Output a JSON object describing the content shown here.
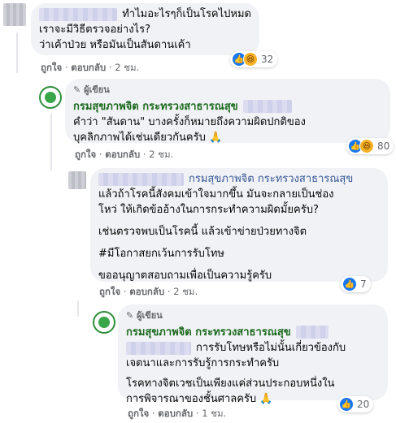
{
  "comments": [
    {
      "lines": [
        "ทำไมอะไรๆก็เป็นโรคไปหมด",
        "เราจะมีวิธีตรวจอย่างไร?",
        "ว่าเค้าป่วย หรือมันเป็นสันดานเค้า"
      ],
      "like": "ถูกใจ",
      "reply": "ตอบกลับ",
      "time": "2 ชม.",
      "reactions": "32"
    },
    {
      "author_tag": "ผู้เขียน",
      "author": "กรมสุขภาพจิต กระทรวงสาธารณสุข",
      "lines": [
        "คำว่า \"สันดาน\" บางครั้งก็หมายถึงความผิดปกติของ",
        "บุคลิกภาพได้เช่นเดียวกันครับ 🙏"
      ],
      "like": "ถูกใจ",
      "reply": "ตอบกลับ",
      "time": "2 ชม.",
      "reactions": "80"
    },
    {
      "mention": "กรมสุขภาพจิต กระทรวงสาธารณสุข",
      "lines": [
        "แล้วถ้าโรคนี้สังคมเข้าใจมากขึ้น มันจะกลายเป็นช่อง",
        "โหว่ ให้เกิดข้ออ้างในการกระทำความผิดมั้ยครับ?",
        "เช่นตรวจพบเป็นโรคนี้ แล้วเข้าข่ายป่วยทางจิต",
        "#มีโอกาสยกเว้นการรับโทษ",
        "ขออนุญาตสอบถามเพื่อเป็นความรู้ครับ"
      ],
      "like": "ถูกใจ",
      "reply": "ตอบกลับ",
      "time": "2 ชม.",
      "reactions": "7"
    },
    {
      "author_tag": "ผู้เขียน",
      "author": "กรมสุขภาพจิต กระทรวงสาธารณสุข",
      "lines": [
        "การรับโทษหรือไม่นั้นเกี่ยวข้องกับ",
        "เจตนาและการรับรู้การกระทำครับ",
        "โรคทางจิตเวชเป็นเพียงแค่ส่วนประกอบหนึ่งใน",
        "การพิจารณาของชั้นศาลครับ 🙏"
      ],
      "like": "ถูกใจ",
      "reply": "ตอบกลับ",
      "time": "1 ชม.",
      "reactions": "20"
    }
  ],
  "colors": {
    "like_blue": "#1877f2",
    "haha_yellow": "#f7b125",
    "bubble": "#f0f2f5",
    "meta_gray": "#65676b"
  }
}
